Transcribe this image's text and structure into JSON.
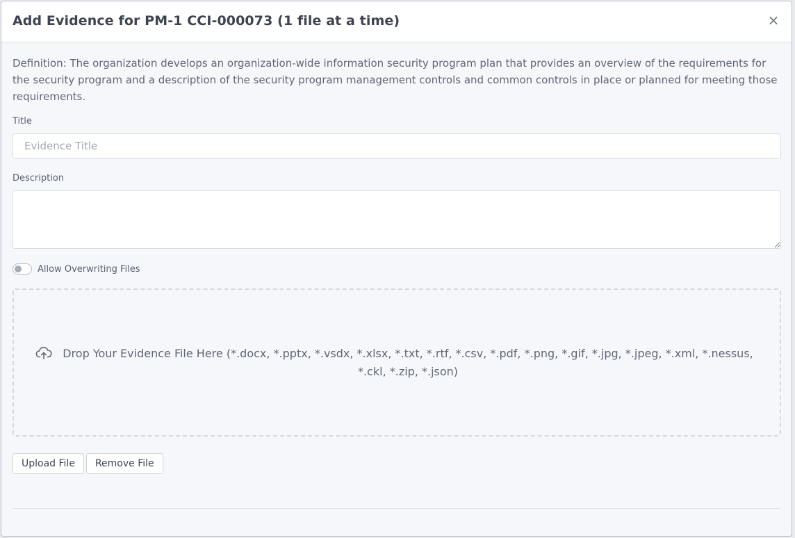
{
  "modal": {
    "title": "Add Evidence for PM-1 CCI-000073 (1 file at a time)",
    "close_label": "×",
    "definition": "Definition: The organization develops an organization-wide information security program plan that provides an overview of the requirements for the security program and a description of the security program management controls and common controls in place or planned for meeting those requirements.",
    "title_field": {
      "label": "Title",
      "placeholder": "Evidence Title",
      "value": ""
    },
    "description_field": {
      "label": "Description",
      "value": ""
    },
    "overwrite_toggle": {
      "label": "Allow Overwriting Files",
      "checked": false
    },
    "dropzone": {
      "icon": "cloud-upload-icon",
      "text": "Drop Your Evidence File Here (*.docx, *.pptx, *.vsdx, *.xlsx, *.txt, *.rtf, *.csv, *.pdf, *.png, *.gif, *.jpg, *.jpeg, *.xml, *.nessus, *.ckl, *.zip, *.json)"
    },
    "buttons": {
      "upload": "Upload File",
      "remove": "Remove File"
    }
  },
  "colors": {
    "modal_bg": "#f6f7fb",
    "header_bg": "#ffffff",
    "border": "#d7dbe1",
    "text": "#606774"
  }
}
